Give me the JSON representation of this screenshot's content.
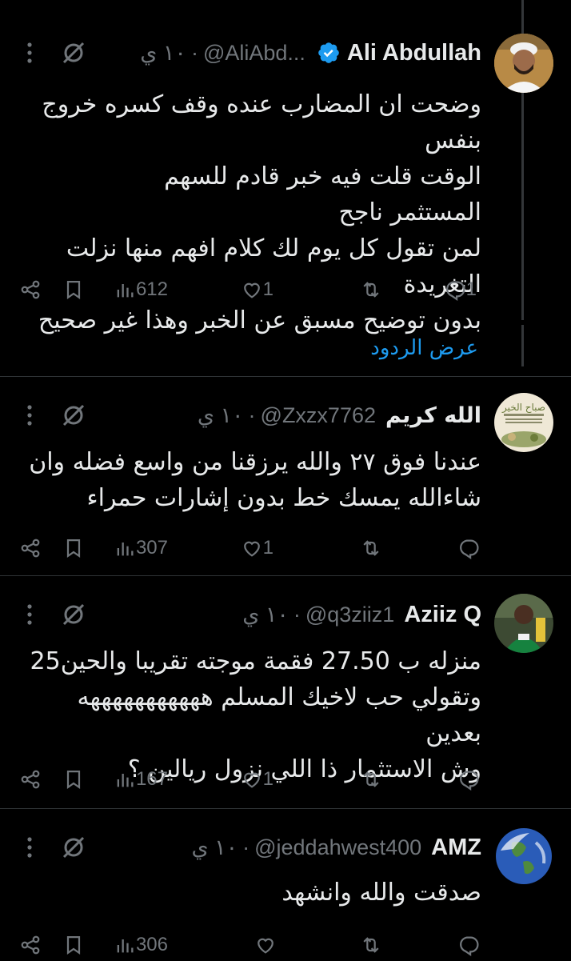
{
  "tweets": [
    {
      "name": "Ali Abdullah",
      "handle": "@AliAbd...",
      "time": "١٠ ي",
      "verified": true,
      "text": "وضحت ان المضارب عنده وقف كسره خروج بنفس\nالوقت قلت فيه خبر قادم للسهم\nالمستثمر ناجح\nلمن تقول كل يوم لك كلام افهم منها نزلت التغريدة\nبدون توضيح مسبق عن الخبر وهذا غير صحيح",
      "replies": "1",
      "retweets": "",
      "likes": "1",
      "views": "612"
    },
    {
      "name": "الله كريم",
      "handle": "@Zxzx7762",
      "time": "١٠ ي",
      "verified": false,
      "text": "عندنا فوق ٢٧  والله يرزقنا من واسع فضله وان\nشاءالله يمسك خط بدون إشارات حمراء",
      "replies": "",
      "retweets": "",
      "likes": "1",
      "views": "307"
    },
    {
      "name": "Aziiz Q",
      "handle": "@q3ziiz1",
      "time": "١٠ ي",
      "verified": false,
      "text": "منزله ب 27.50 فقمة موجته تقريبا والحين25\nوتقولي حب لاخيك المسلم هههههههههههه بعدين\nوش الاستثمار ذا اللي نزول ريالين ؟",
      "replies": "",
      "retweets": "",
      "likes": "1",
      "views": "167"
    },
    {
      "name": "AMZ",
      "handle": "@jeddahwest400",
      "time": "١٠ ي",
      "verified": false,
      "text": "صدقت والله وانشهد",
      "replies": "",
      "retweets": "",
      "likes": "",
      "views": "306"
    }
  ],
  "show_replies_label": "عرض الردود",
  "colors": {
    "background": "#000000",
    "muted": "#71767b",
    "accent": "#1d9bf0",
    "separator": "#2f3336"
  },
  "icons": [
    "reply-icon",
    "retweet-icon",
    "like-icon",
    "views-icon",
    "bookmark-icon",
    "share-icon",
    "grok-icon",
    "more-icon",
    "verified-icon"
  ]
}
